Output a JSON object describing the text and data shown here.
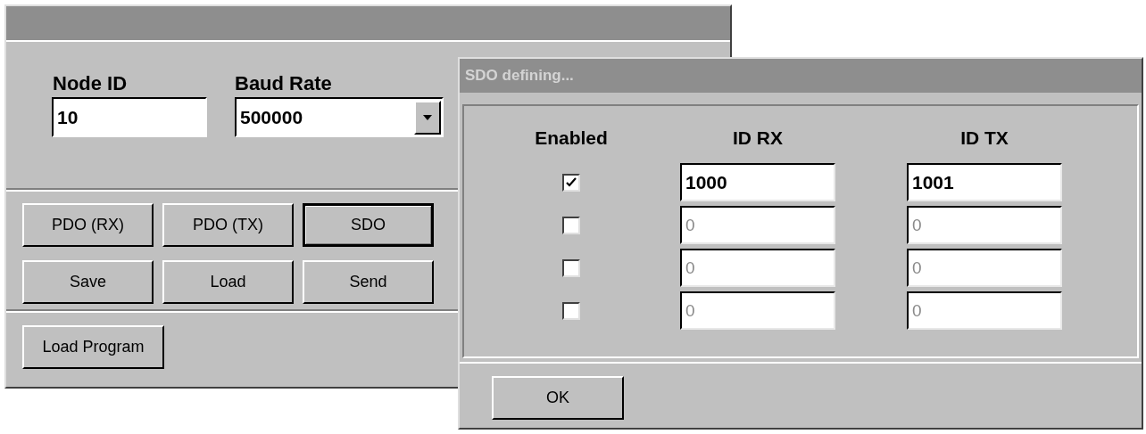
{
  "main_window": {
    "node_id": {
      "label": "Node ID",
      "value": "10"
    },
    "baud_rate": {
      "label": "Baud Rate",
      "value": "500000"
    },
    "buttons": [
      {
        "label": "PDO (RX)",
        "default": false
      },
      {
        "label": "PDO (TX)",
        "default": false
      },
      {
        "label": "SDO",
        "default": true
      },
      {
        "label": "Save",
        "default": false
      },
      {
        "label": "Load",
        "default": false
      },
      {
        "label": "Send",
        "default": false
      }
    ],
    "load_program_button": "Load Program"
  },
  "dialog": {
    "title": "SDO defining...",
    "columns": [
      "Enabled",
      "ID RX",
      "ID TX"
    ],
    "rows": [
      {
        "checked": true,
        "disabled": false,
        "id_rx": "1000",
        "id_tx": "1001"
      },
      {
        "checked": false,
        "disabled": true,
        "id_rx": "0",
        "id_tx": "0"
      },
      {
        "checked": false,
        "disabled": true,
        "id_rx": "0",
        "id_tx": "0"
      },
      {
        "checked": false,
        "disabled": true,
        "id_rx": "0",
        "id_tx": "0"
      }
    ],
    "ok_button": "OK"
  }
}
